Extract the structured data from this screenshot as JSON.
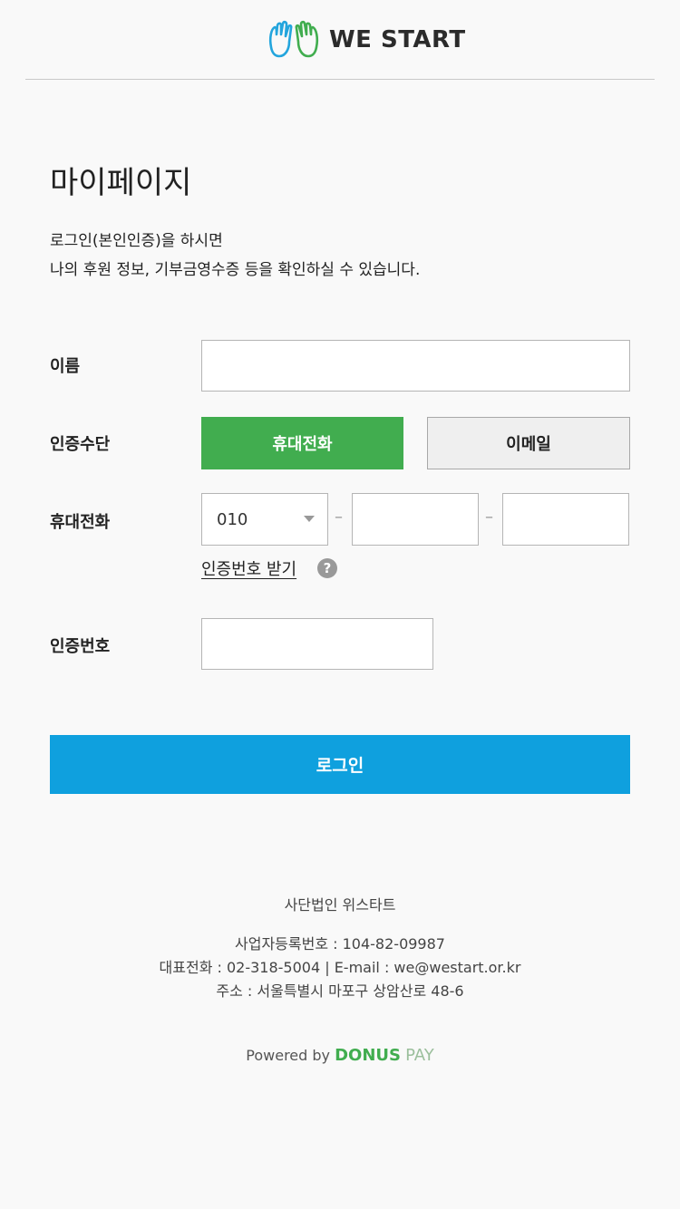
{
  "header": {
    "logo_text": "WE START",
    "logo_icon": "hands-logo-icon"
  },
  "page": {
    "title": "마이페이지",
    "intro_line1": "로그인(본인인증)을 하시면",
    "intro_line2": "나의 후원 정보, 기부금영수증 등을 확인하실 수 있습니다."
  },
  "form": {
    "name_label": "이름",
    "name_value": "",
    "auth_method_label": "인증수단",
    "auth_phone_label": "휴대전화",
    "auth_email_label": "이메일",
    "phone_label": "휴대전화",
    "phone_prefix": "010",
    "phone_separator": "–",
    "phone_mid_value": "",
    "phone_last_value": "",
    "get_code_link": "인증번호 받기",
    "help_icon_glyph": "?",
    "code_label": "인증번호",
    "code_value": "",
    "login_button": "로그인"
  },
  "footer": {
    "org_name": "사단법인 위스타트",
    "business_no": "사업자등록번호 : 104-82-09987",
    "contact": "대표전화 : 02-318-5004 | E-mail : we@westart.or.kr",
    "address": "주소 : 서울특별시 마포구 상암산로 48-6",
    "powered_prefix": "Powered by",
    "powered_brand": "DONUS",
    "powered_pay": "PAY"
  },
  "colors": {
    "accent_green": "#41ad4f",
    "login_blue": "#0fa0de"
  }
}
